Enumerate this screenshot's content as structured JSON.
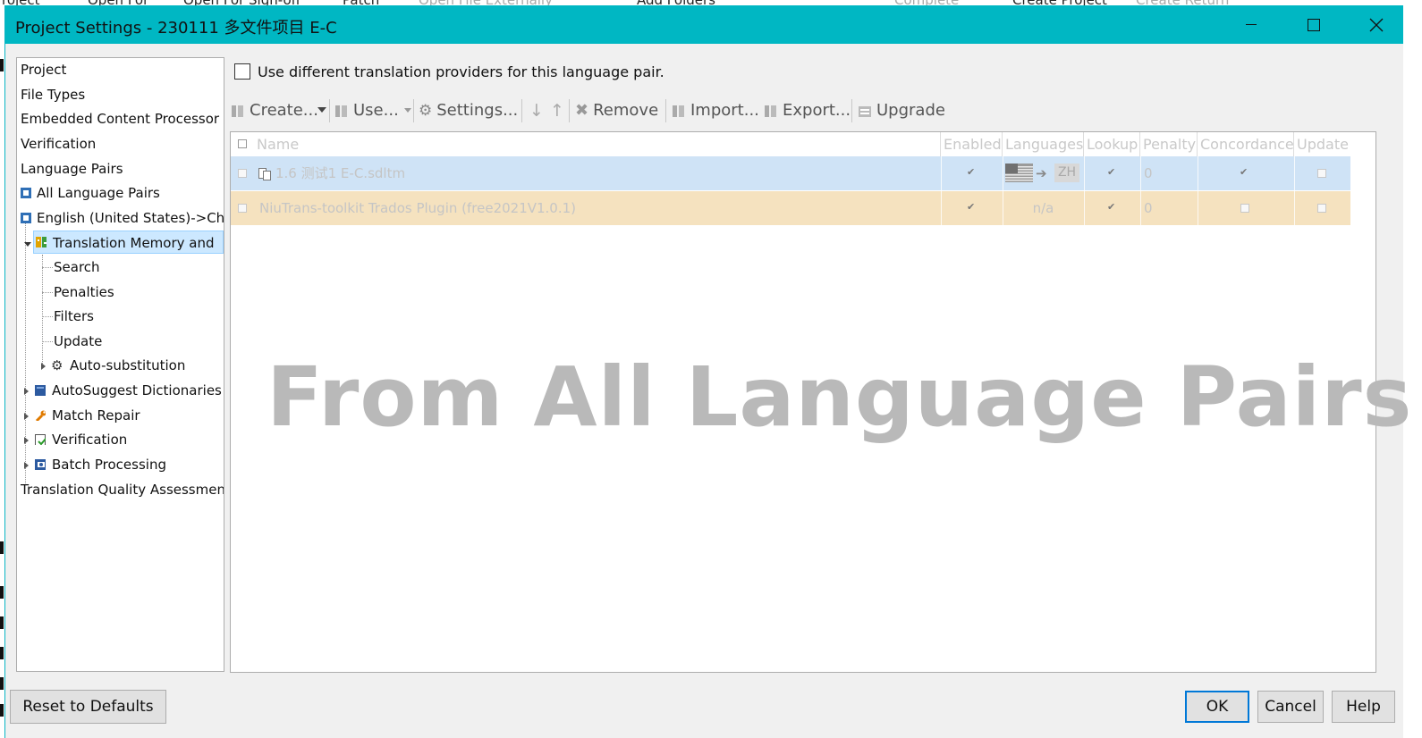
{
  "background_app": {
    "items": [
      "roject",
      "Open For",
      "Open For Sign-off",
      "Patch",
      "Open File Externally",
      "Add Folders",
      "Complete",
      "Create Project",
      "Create Return"
    ]
  },
  "window": {
    "title": "Project Settings - 230111 多文件项目 E-C",
    "accent_color": "#00b7c3"
  },
  "tree": {
    "items": [
      {
        "label": "Project"
      },
      {
        "label": "File Types"
      },
      {
        "label": "Embedded Content Processor"
      },
      {
        "label": "Verification"
      },
      {
        "label": "Language Pairs"
      },
      {
        "label": "All Language Pairs",
        "icon": "language-pair-icon"
      },
      {
        "label": "English (United States)->Ch",
        "icon": "language-pair-icon"
      },
      {
        "label": "Translation Memory and",
        "icon": "translation-memory-icon",
        "selected": true
      },
      {
        "label": "Search"
      },
      {
        "label": "Penalties"
      },
      {
        "label": "Filters"
      },
      {
        "label": "Update"
      },
      {
        "label": "Auto-substitution",
        "icon": "gear-icon"
      },
      {
        "label": "AutoSuggest Dictionaries",
        "icon": "dictionary-icon"
      },
      {
        "label": "Match Repair",
        "icon": "wrench-icon"
      },
      {
        "label": "Verification",
        "icon": "verification-icon"
      },
      {
        "label": "Batch Processing",
        "icon": "batch-icon"
      },
      {
        "label": "Translation Quality Assessmen"
      }
    ]
  },
  "options": {
    "different_providers_label": "Use different translation providers for this language pair.",
    "different_providers_checked": false
  },
  "toolbar": {
    "create": "Create...",
    "use": "Use...",
    "settings": "Settings...",
    "remove": "Remove",
    "import": "Import...",
    "export": "Export...",
    "upgrade": "Upgrade"
  },
  "grid": {
    "columns": [
      "Name",
      "Enabled",
      "Languages",
      "Lookup",
      "Penalty",
      "Concordance",
      "Update"
    ],
    "rows": [
      {
        "name": "1.6 测试1 E-C.sdltm",
        "enabled": true,
        "languages_target": "ZH",
        "lookup": true,
        "penalty": "0",
        "concordance": true,
        "update": false,
        "highlight": "#cfe3f6"
      },
      {
        "name": "NiuTrans-toolkit Trados Plugin  (free2021V1.0.1)",
        "enabled": true,
        "languages": "n/a",
        "lookup": true,
        "penalty": "0",
        "concordance": false,
        "update": false,
        "highlight": "#f5e2bf"
      }
    ]
  },
  "watermark": "From All Language Pairs",
  "buttons": {
    "reset": "Reset to Defaults",
    "ok": "OK",
    "cancel": "Cancel",
    "help": "Help"
  }
}
